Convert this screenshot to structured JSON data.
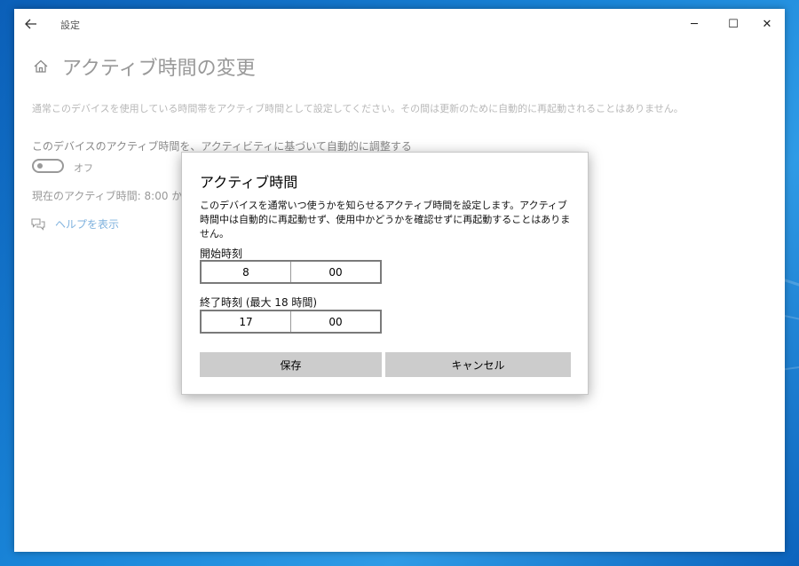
{
  "window": {
    "title": "設定",
    "controls": {
      "minimize": "─",
      "maximize": "☐",
      "close": "✕"
    }
  },
  "page": {
    "title": "アクティブ時間の変更",
    "description": "通常このデバイスを使用している時間帯をアクティブ時間として設定してください。その間は更新のために自動的に再起動されることはありません。",
    "toggle_label": "このデバイスのアクティブ時間を、アクティビティに基づいて自動的に調整する",
    "toggle_state": "オフ",
    "current_hours": "現在のアクティブ時間: 8:00 から 17:00",
    "help_link": "ヘルプを表示"
  },
  "dialog": {
    "title": "アクティブ時間",
    "text": "このデバイスを通常いつ使うかを知らせるアクティブ時間を設定します。アクティブ時間中は自動的に再起動せず、使用中かどうかを確認せずに再起動することはありません。",
    "start": {
      "label": "開始時刻",
      "hour": "8",
      "minute": "00"
    },
    "end": {
      "label": "終了時刻 (最大 18 時間)",
      "hour": "17",
      "minute": "00"
    },
    "save_label": "保存",
    "cancel_label": "キャンセル"
  },
  "icons": {
    "back": "back-arrow-icon",
    "home": "home-icon",
    "help": "help-chat-icon"
  },
  "colors": {
    "desktop": "#1a86d9",
    "button_bg": "#cccccc",
    "link": "#7fb2de"
  }
}
